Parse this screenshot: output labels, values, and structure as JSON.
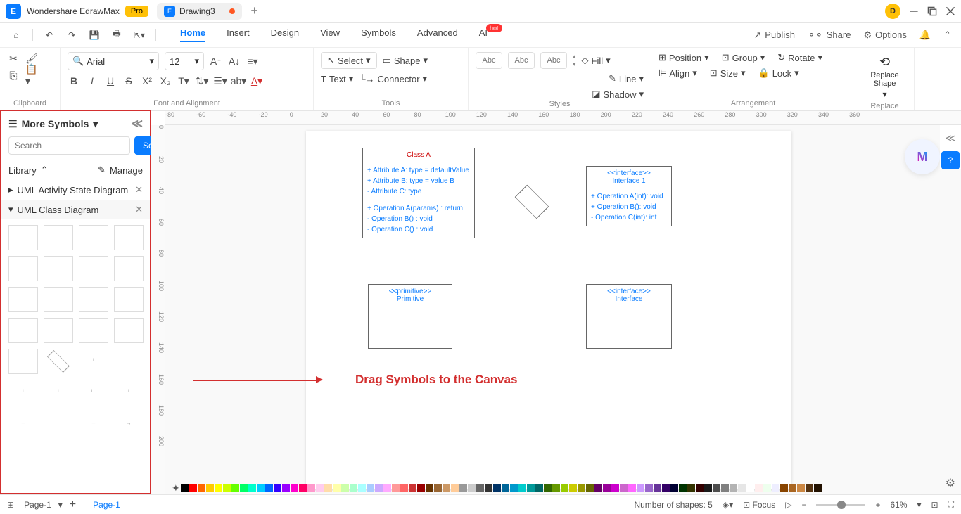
{
  "app": {
    "name": "Wondershare EdrawMax",
    "badge": "Pro"
  },
  "tab": {
    "title": "Drawing3"
  },
  "user": {
    "initial": "D"
  },
  "menu": {
    "home": "Home",
    "insert": "Insert",
    "design": "Design",
    "view": "View",
    "symbols": "Symbols",
    "advanced": "Advanced",
    "ai": "AI",
    "ai_badge": "hot"
  },
  "quick_right": {
    "publish": "Publish",
    "share": "Share",
    "options": "Options"
  },
  "ribbon": {
    "clipboard": "Clipboard",
    "font_alignment": "Font and Alignment",
    "tools": "Tools",
    "styles": "Styles",
    "arrangement": "Arrangement",
    "replace": "Replace",
    "font": "Arial",
    "size": "12",
    "select": "Select",
    "shape": "Shape",
    "text": "Text",
    "connector": "Connector",
    "abc": "Abc",
    "fill": "Fill",
    "line": "Line",
    "shadow": "Shadow",
    "position": "Position",
    "group": "Group",
    "rotate": "Rotate",
    "align": "Align",
    "size_btn": "Size",
    "lock": "Lock",
    "replace_shape": "Replace\nShape"
  },
  "sidebar": {
    "more_symbols": "More Symbols",
    "search_placeholder": "Search",
    "search_btn": "Search",
    "library": "Library",
    "manage": "Manage",
    "cat1": "UML Activity State Diagram",
    "cat2": "UML Class Diagram"
  },
  "ruler_h": [
    "-80",
    "-60",
    "-40",
    "-20",
    "0",
    "20",
    "40",
    "60",
    "80",
    "100",
    "120",
    "140",
    "160",
    "180",
    "200",
    "220",
    "240",
    "260",
    "280",
    "300",
    "320",
    "340",
    "360"
  ],
  "ruler_v": [
    "0",
    "20",
    "40",
    "60",
    "80",
    "100",
    "120",
    "140",
    "160",
    "180",
    "200"
  ],
  "class_a": {
    "title": "Class A",
    "attr1": "+   Attribute A: type = defaultValue",
    "attr2": "+   Attribute B: type = value B",
    "attr3": "-   Attribute C: type",
    "op1": "+   Operation A(params) : return",
    "op2": "-   Operation B() : void",
    "op3": "-   Operation C() : void"
  },
  "interface1": {
    "stereo": "<<interface>>",
    "name": "Interface 1",
    "op1": "+   Operation A(int): void",
    "op2": "+   Operation B(): void",
    "op3": "-   Operation C(int): int"
  },
  "primitive": {
    "stereo": "<<primitive>>",
    "name": "Primitive"
  },
  "interface2": {
    "stereo": "<<interface>>",
    "name": "Interface"
  },
  "annotation": "Drag Symbols to the Canvas",
  "status": {
    "page1": "Page-1",
    "shapes_label": "Number of shapes: 5",
    "focus": "Focus",
    "zoom": "61%"
  },
  "colors": [
    "#000000",
    "#ff0000",
    "#ff6600",
    "#ffcc00",
    "#ffff00",
    "#ccff00",
    "#66ff00",
    "#00ff66",
    "#00ffcc",
    "#00ccff",
    "#0066ff",
    "#3300ff",
    "#9900ff",
    "#ff00cc",
    "#ff0066",
    "#ff99cc",
    "#ffccee",
    "#ffddaa",
    "#ffffaa",
    "#ccffaa",
    "#aaffcc",
    "#aaffff",
    "#aaccff",
    "#ccaaff",
    "#ffaaff",
    "#ff9999",
    "#ff6666",
    "#cc3333",
    "#990000",
    "#663300",
    "#996633",
    "#cc9966",
    "#ffcc99",
    "#999999",
    "#cccccc",
    "#666666",
    "#333333",
    "#003366",
    "#006699",
    "#0099cc",
    "#00cccc",
    "#009999",
    "#006666",
    "#336600",
    "#669900",
    "#99cc00",
    "#cccc00",
    "#999900",
    "#666600",
    "#660066",
    "#990099",
    "#cc00cc",
    "#cc66cc",
    "#ff66ff",
    "#cc99ff",
    "#9966cc",
    "#663399",
    "#330066",
    "#000033",
    "#003300",
    "#333300",
    "#330000",
    "#1a1a1a",
    "#4d4d4d",
    "#808080",
    "#b3b3b3",
    "#e6e6e6",
    "#ffffff",
    "#ffeeee",
    "#eeffee",
    "#eeeeff",
    "#884400",
    "#aa6622",
    "#cc8844",
    "#553311",
    "#221100"
  ]
}
